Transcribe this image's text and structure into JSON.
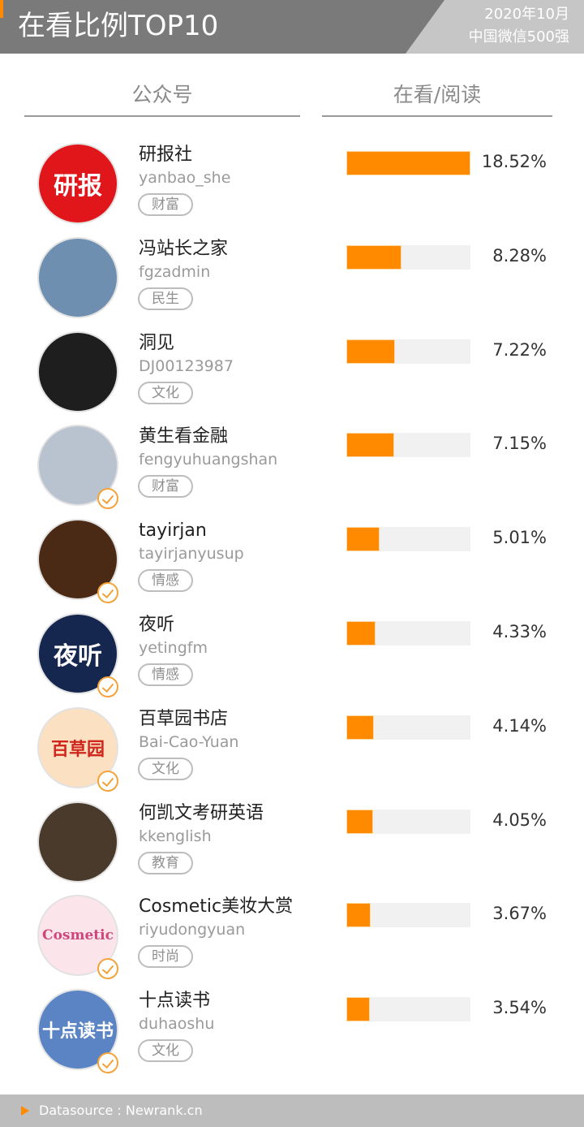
{
  "header": {
    "title": "在看比例TOP10",
    "date": "2020年10月",
    "subtitle": "中国微信500强",
    "accent_color": "#ff8a00"
  },
  "columns": {
    "account": "公众号",
    "ratio": "在看/阅读"
  },
  "chart_data": {
    "type": "bar",
    "orientation": "horizontal",
    "value_unit": "%",
    "xlim": [
      0,
      18.52
    ],
    "bar_color": "#ff8a00",
    "track_color": "#f1f1f1",
    "categories": [
      "研报社",
      "冯站长之家",
      "洞见",
      "黄生看金融",
      "tayirjan",
      "夜听",
      "百草园书店",
      "何凯文考研英语",
      "Cosmetic美妆大赏",
      "十点读书"
    ],
    "values": [
      18.52,
      8.28,
      7.22,
      7.15,
      5.01,
      4.33,
      4.14,
      4.05,
      3.67,
      3.54
    ],
    "data_labels": [
      "18.52%",
      "8.28%",
      "7.22%",
      "7.15%",
      "5.01%",
      "4.33%",
      "4.14%",
      "4.05%",
      "3.67%",
      "3.54%"
    ]
  },
  "accounts": [
    {
      "name": "研报社",
      "handle": "yanbao_she",
      "tag": "财富",
      "verified": false,
      "avatar_text": "研报",
      "avatar_color": "#e0161b",
      "avatar_text_color": "#ffffff"
    },
    {
      "name": "冯站长之家",
      "handle": "fgzadmin",
      "tag": "民生",
      "verified": false,
      "avatar_text": "",
      "avatar_color": "#6f8fb0",
      "avatar_text_color": "#ffffff"
    },
    {
      "name": "洞见",
      "handle": "DJ00123987",
      "tag": "文化",
      "verified": false,
      "avatar_text": "",
      "avatar_color": "#1e1e1e",
      "avatar_text_color": "#ffffff"
    },
    {
      "name": "黄生看金融",
      "handle": "fengyuhuangshan",
      "tag": "财富",
      "verified": true,
      "avatar_text": "",
      "avatar_color": "#b8c3cf",
      "avatar_text_color": "#ffffff"
    },
    {
      "name": "tayirjan",
      "handle": "tayirjanyusup",
      "tag": "情感",
      "verified": true,
      "avatar_text": "",
      "avatar_color": "#4a2a14",
      "avatar_text_color": "#f0d0a0"
    },
    {
      "name": "夜听",
      "handle": "yetingfm",
      "tag": "情感",
      "verified": true,
      "avatar_text": "夜听",
      "avatar_color": "#15264f",
      "avatar_text_color": "#ffffff"
    },
    {
      "name": "百草园书店",
      "handle": "Bai-Cao-Yuan",
      "tag": "文化",
      "verified": true,
      "avatar_text": "百草园",
      "avatar_color": "#fbe0c2",
      "avatar_text_color": "#d0261c"
    },
    {
      "name": "何凯文考研英语",
      "handle": "kkenglish",
      "tag": "教育",
      "verified": false,
      "avatar_text": "",
      "avatar_color": "#4a3a2c",
      "avatar_text_color": "#ffffff"
    },
    {
      "name": "Cosmetic美妆大赏",
      "handle": "riyudongyuan",
      "tag": "时尚",
      "verified": true,
      "avatar_text": "Cosmetic",
      "avatar_color": "#fbe4ea",
      "avatar_text_color": "#d0467a"
    },
    {
      "name": "十点读书",
      "handle": "duhaoshu",
      "tag": "文化",
      "verified": true,
      "avatar_text": "十点读书",
      "avatar_color": "#5b84c4",
      "avatar_text_color": "#ffffff"
    }
  ],
  "footer": {
    "source": "Datasource : Newrank.cn"
  }
}
